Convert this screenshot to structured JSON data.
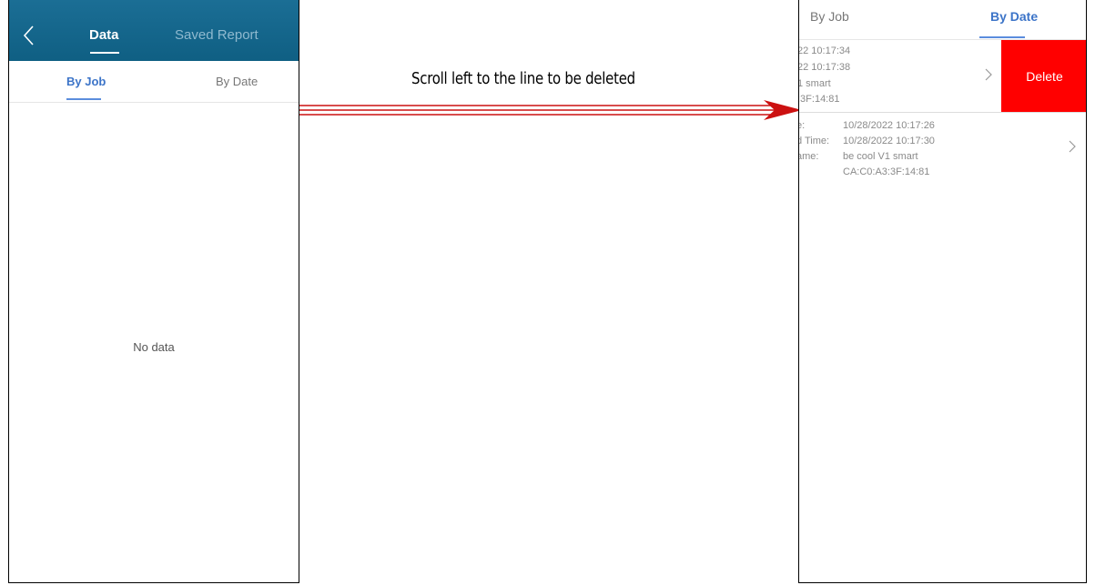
{
  "left_screen": {
    "header_tabs": {
      "data": "Data",
      "saved_report": "Saved Report"
    },
    "sub_tabs": {
      "by_job": "By Job",
      "by_date": "By Date"
    },
    "empty_message": "No data"
  },
  "instruction": "Scroll left to the line to be deleted",
  "right_screen": {
    "tabs": {
      "by_job": "By Job",
      "by_date": "By Date"
    },
    "record1": {
      "lines": [
        "22 10:17:34",
        "22 10:17:38",
        "1 smart",
        ":3F:14:81"
      ]
    },
    "delete_label": "Delete",
    "record2": {
      "labels": [
        "e:",
        "d Time:",
        "ame:"
      ],
      "values": [
        "10/28/2022 10:17:26",
        "10/28/2022 10:17:30",
        "be cool V1 smart",
        "CA:C0:A3:3F:14:81"
      ]
    }
  },
  "colors": {
    "header": "#0f5f83",
    "accent": "#3c74c8",
    "delete": "#ff0000",
    "arrow": "#cc1111"
  },
  "icons": {
    "back": "chevron-left-icon",
    "row": "chevron-right-icon"
  }
}
